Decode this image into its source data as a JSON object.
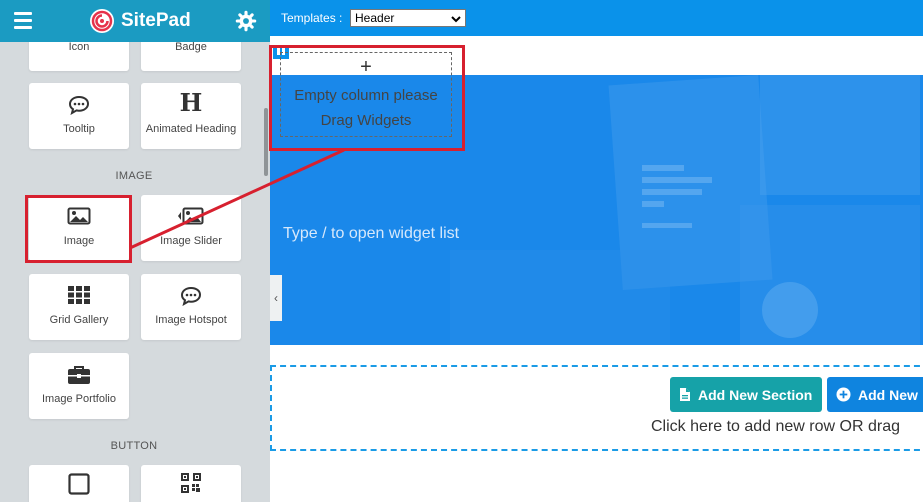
{
  "sidebar": {
    "brand": "SitePad",
    "widgets_top": [
      {
        "label": "Icon",
        "icon": "icon-widget-icon"
      },
      {
        "label": "Badge",
        "icon": "badge-icon"
      },
      {
        "label": "Tooltip",
        "icon": "speech-bubble-icon"
      },
      {
        "label": "Animated Heading",
        "icon": "heading-icon"
      }
    ],
    "sections": {
      "image": {
        "title": "IMAGE",
        "items": [
          {
            "label": "Image",
            "icon": "image-icon"
          },
          {
            "label": "Image Slider",
            "icon": "image-slider-icon"
          },
          {
            "label": "Grid Gallery",
            "icon": "grid-icon"
          },
          {
            "label": "Image Hotspot",
            "icon": "speech-bubble-icon"
          },
          {
            "label": "Image Portfolio",
            "icon": "briefcase-icon"
          }
        ]
      },
      "button": {
        "title": "BUTTON",
        "items": [
          {
            "label": "",
            "icon": "square-icon"
          },
          {
            "label": "",
            "icon": "qr-code-icon"
          }
        ]
      }
    }
  },
  "topbar": {
    "templates_label": "Templates :",
    "templates_value": "Header"
  },
  "canvas": {
    "empty_column_plus": "+",
    "empty_column_text": [
      "Empty column please",
      "Drag Widgets"
    ],
    "hero_prompt": "Type / to open widget list",
    "collapse_arrow": "‹",
    "add_section_label": "Add New Section",
    "add_new_label": "Add New",
    "add_hint": "Click here to add new row OR drag"
  },
  "colors": {
    "sidebar_header": "#1b9bc2",
    "topbar": "#0a92ea",
    "hero": "#1a88ea",
    "highlight": "#d7202f",
    "add_section_button": "#16a2a8",
    "add_new_button": "#0f84df"
  }
}
